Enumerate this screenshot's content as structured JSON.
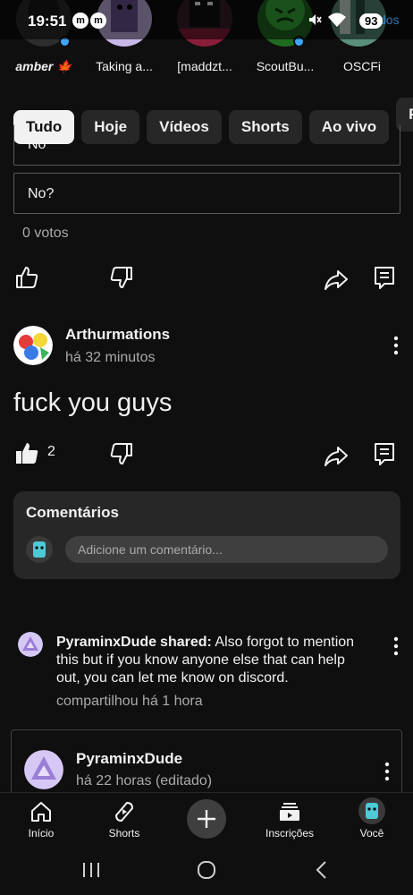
{
  "status_bar": {
    "time": "19:51",
    "notification_icons": [
      "m",
      "m"
    ],
    "mute_icon": "mute-icon",
    "wifi_icon": "wifi-icon",
    "battery": "93",
    "peek_text": "dos"
  },
  "subscriptions": [
    {
      "name": "amber 🍁",
      "live": true
    },
    {
      "name": "Taking a...",
      "live": false
    },
    {
      "name": "[maddzt...",
      "live": false
    },
    {
      "name": "ScoutBu...",
      "live": true
    },
    {
      "name": "OSCFi",
      "live": false
    }
  ],
  "chips": [
    {
      "label": "Tudo",
      "active": true
    },
    {
      "label": "Hoje",
      "active": false
    },
    {
      "label": "Vídeos",
      "active": false
    },
    {
      "label": "Shorts",
      "active": false
    },
    {
      "label": "Ao vivo",
      "active": false
    },
    {
      "label": "P",
      "active": false
    }
  ],
  "poll": {
    "options": [
      "No",
      "No?"
    ],
    "votes": "0 votos"
  },
  "post": {
    "author": "Arthurmations",
    "time": "há 32 minutos",
    "text": "fuck you guys",
    "likes": "2"
  },
  "comments": {
    "title": "Comentários",
    "placeholder": "Adicione um comentário..."
  },
  "shared": {
    "user": "PyraminxDude",
    "label": "shared:",
    "text": "Also forgot to mention this but if you know anyone else that can help out, you can let me know on discord.",
    "time": "compartilhou há 1 hora",
    "card_author": "PyraminxDude",
    "card_time": "há 22 horas (editado)"
  },
  "bottom_nav": {
    "home": "Início",
    "shorts": "Shorts",
    "subscriptions": "Inscrições",
    "you": "Você"
  },
  "colors": {
    "background": "#0f0f0f",
    "surface": "#272727",
    "accent": "#3ea6ff",
    "text_secondary": "#aaaaaa"
  }
}
